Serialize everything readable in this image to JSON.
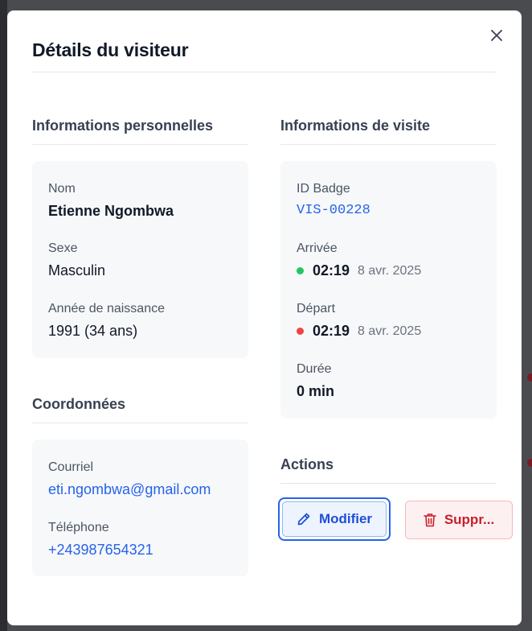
{
  "dialog": {
    "title": "Détails du visiteur"
  },
  "personal": {
    "section_title": "Informations personnelles",
    "name_label": "Nom",
    "name_value": "Etienne Ngombwa",
    "sex_label": "Sexe",
    "sex_value": "Masculin",
    "birth_label": "Année de naissance",
    "birth_value": "1991 (34 ans)"
  },
  "contact": {
    "section_title": "Coordonnées",
    "email_label": "Courriel",
    "email_value": "eti.ngombwa@gmail.com",
    "phone_label": "Téléphone",
    "phone_value": "+243987654321"
  },
  "visit": {
    "section_title": "Informations de visite",
    "badge_label": "ID Badge",
    "badge_value": "VIS-00228",
    "arrival_label": "Arrivée",
    "arrival_time": "02:19",
    "arrival_date": "8 avr. 2025",
    "departure_label": "Départ",
    "departure_time": "02:19",
    "departure_date": "8 avr. 2025",
    "duration_label": "Durée",
    "duration_value": "0 min"
  },
  "actions": {
    "section_title": "Actions",
    "edit_label": "Modifier",
    "delete_label": "Suppr..."
  },
  "colors": {
    "accent": "#2563eb",
    "arrival_dot": "#22c55e",
    "departure_dot": "#ef4444",
    "danger": "#c81e2b"
  },
  "icons": {
    "close": "close-icon",
    "edit": "pencil-icon",
    "delete": "trash-icon"
  }
}
